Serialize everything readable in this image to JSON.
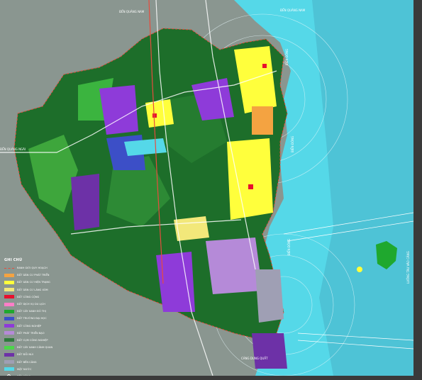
{
  "legend": {
    "title": "GHI CHÚ",
    "items": [
      {
        "label": "RANH GIỚI QUY HOẠCH",
        "color": "#e84c3d",
        "kind": "line"
      },
      {
        "label": "ĐẤT DÂN CƯ PHÁT TRIỂN",
        "color": "#f4a341",
        "kind": "fill"
      },
      {
        "label": "ĐẤT DÂN CƯ HIỆN TRẠNG",
        "color": "#ffff3c",
        "kind": "fill"
      },
      {
        "label": "ĐẤT DÂN CƯ LÀNG XÓM",
        "color": "#f2e87a",
        "kind": "fill"
      },
      {
        "label": "ĐẤT CÔNG CỘNG",
        "color": "#e8102d",
        "kind": "fill"
      },
      {
        "label": "ĐẤT DỊCH VỤ DU LỊCH",
        "color": "#ff7ec8",
        "kind": "fill"
      },
      {
        "label": "ĐẤT CÂY XANH ĐÔ THỊ",
        "color": "#1fa82e",
        "kind": "fill"
      },
      {
        "label": "ĐẤT TRƯỜNG ĐẠI HỌC",
        "color": "#3c4fc7",
        "kind": "fill"
      },
      {
        "label": "ĐẤT CÔNG NGHIỆP",
        "color": "#8e3bd9",
        "kind": "fill"
      },
      {
        "label": "ĐẤT PHÁT TRIỂN BẠO",
        "color": "#b58ad8",
        "kind": "fill"
      },
      {
        "label": "ĐẤT CỤM CÔNG NGHIỆP",
        "color": "#2f7a3c",
        "kind": "fill"
      },
      {
        "label": "ĐẤT CÂY XANH CẢNH QUAN",
        "color": "#4cd64a",
        "kind": "fill"
      },
      {
        "label": "ĐẤT ĐỒI NÚI",
        "color": "#6d31a7",
        "kind": "fill"
      },
      {
        "label": "ĐẤT BẾN CẢNG",
        "color": "#9f9fb4",
        "kind": "fill"
      },
      {
        "label": "MẶT NƯỚC",
        "color": "#55d8e8",
        "kind": "fill"
      },
      {
        "label": "BẾN CẢNG",
        "color": "#ffffff",
        "kind": "symbol"
      },
      {
        "label": "GA TÀU HỎA",
        "color": "#ffffff",
        "kind": "symbol"
      }
    ]
  },
  "labels": {
    "sea_north": "BIỂN ĐÔNG",
    "sea_mid": "BIỂN ĐÔNG",
    "sea_south": "BIỂN ĐÔNG",
    "channel": "LUỒNG TÀU VÀO CẢNG",
    "port": "CẢNG DUNG QUẤT",
    "highway_west": "ĐẾN QUẢNG NGÃI",
    "highway_north": "ĐẾN QUẢNG NAM",
    "highway_ne": "ĐẾN QUẢNG NAM",
    "center": "CẦU"
  },
  "colors": {
    "sea": "#55d8e8",
    "sea_deep": "#4ab5c9",
    "forest": "#1d6e2a",
    "surrounding_land": "#8a9690",
    "background": "#3b3b3b"
  }
}
